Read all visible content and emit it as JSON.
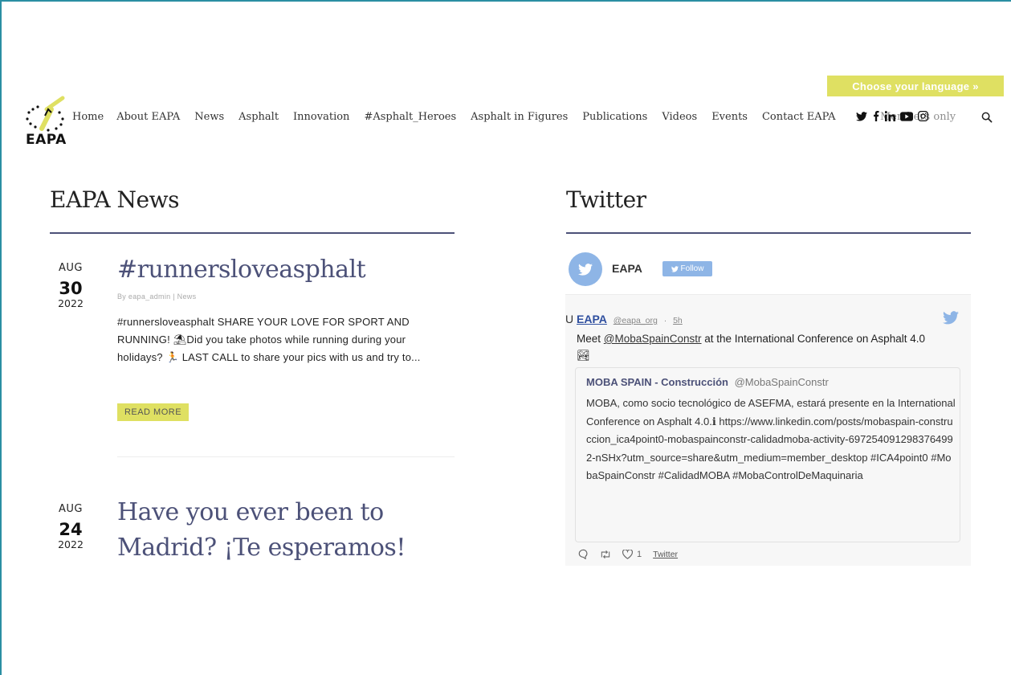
{
  "header": {
    "language_button": "Choose your language »",
    "logo_text": "EAPA",
    "nav": [
      "Home",
      "About EAPA",
      "News",
      "Asphalt",
      "Innovation",
      "#Asphalt_Heroes",
      "Asphalt in Figures",
      "Publications",
      "Videos",
      "Events",
      "Contact EAPA",
      "Members only"
    ],
    "social_icons": [
      "twitter-icon",
      "facebook-icon",
      "linkedin-icon",
      "youtube-icon",
      "instagram-icon"
    ]
  },
  "news": {
    "section_title": "EAPA News",
    "posts": [
      {
        "month": "AUG",
        "day": "30",
        "year": "2022",
        "title": "#runnersloveasphalt",
        "byline": "By eapa_admin | News",
        "excerpt": "#runnersloveasphalt SHARE YOUR LOVE FOR SPORT AND RUNNING! ⛱Did you take photos while running during your holidays? 🏃 LAST CALL to share your pics with us and try to...",
        "read_more": "READ MORE"
      },
      {
        "month": "AUG",
        "day": "24",
        "year": "2022",
        "title": "Have you ever been to Madrid? ¡Te esperamos!"
      }
    ]
  },
  "twitter": {
    "section_title": "Twitter",
    "account_name": "EAPA",
    "follow_label": "Follow",
    "tweet": {
      "prefix": "U",
      "name": "EAPA",
      "handle": "@eapa_org",
      "separator": "·",
      "time": "5h",
      "text_before": "Meet ",
      "mention": "@MobaSpainConstr",
      "text_after": " at the International Conference on Asphalt 4.0 🏞",
      "quote": {
        "name": "MOBA SPAIN - Construcción",
        "handle": "@MobaSpainConstr",
        "body": "MOBA, como socio tecnológico de ASEFMA, estará presente en la International Conference on Asphalt 4.0.ℹ https://www.linkedin.com/posts/mobaspain-construccion_ica4point0-mobaspainconstr-calidadmoba-activity-6972540912983764992-nSHx?utm_source=share&utm_medium=member_desktop #ICA4point0 #MobaSpainConstr #CalidadMOBA #MobaControlDeMaquinaria"
      },
      "likes": "1",
      "link_label": "Twitter"
    }
  },
  "colors": {
    "accent_yellow": "#dfe062",
    "title_navy": "#4c5178",
    "twitter_blue": "#8eb5e6"
  }
}
